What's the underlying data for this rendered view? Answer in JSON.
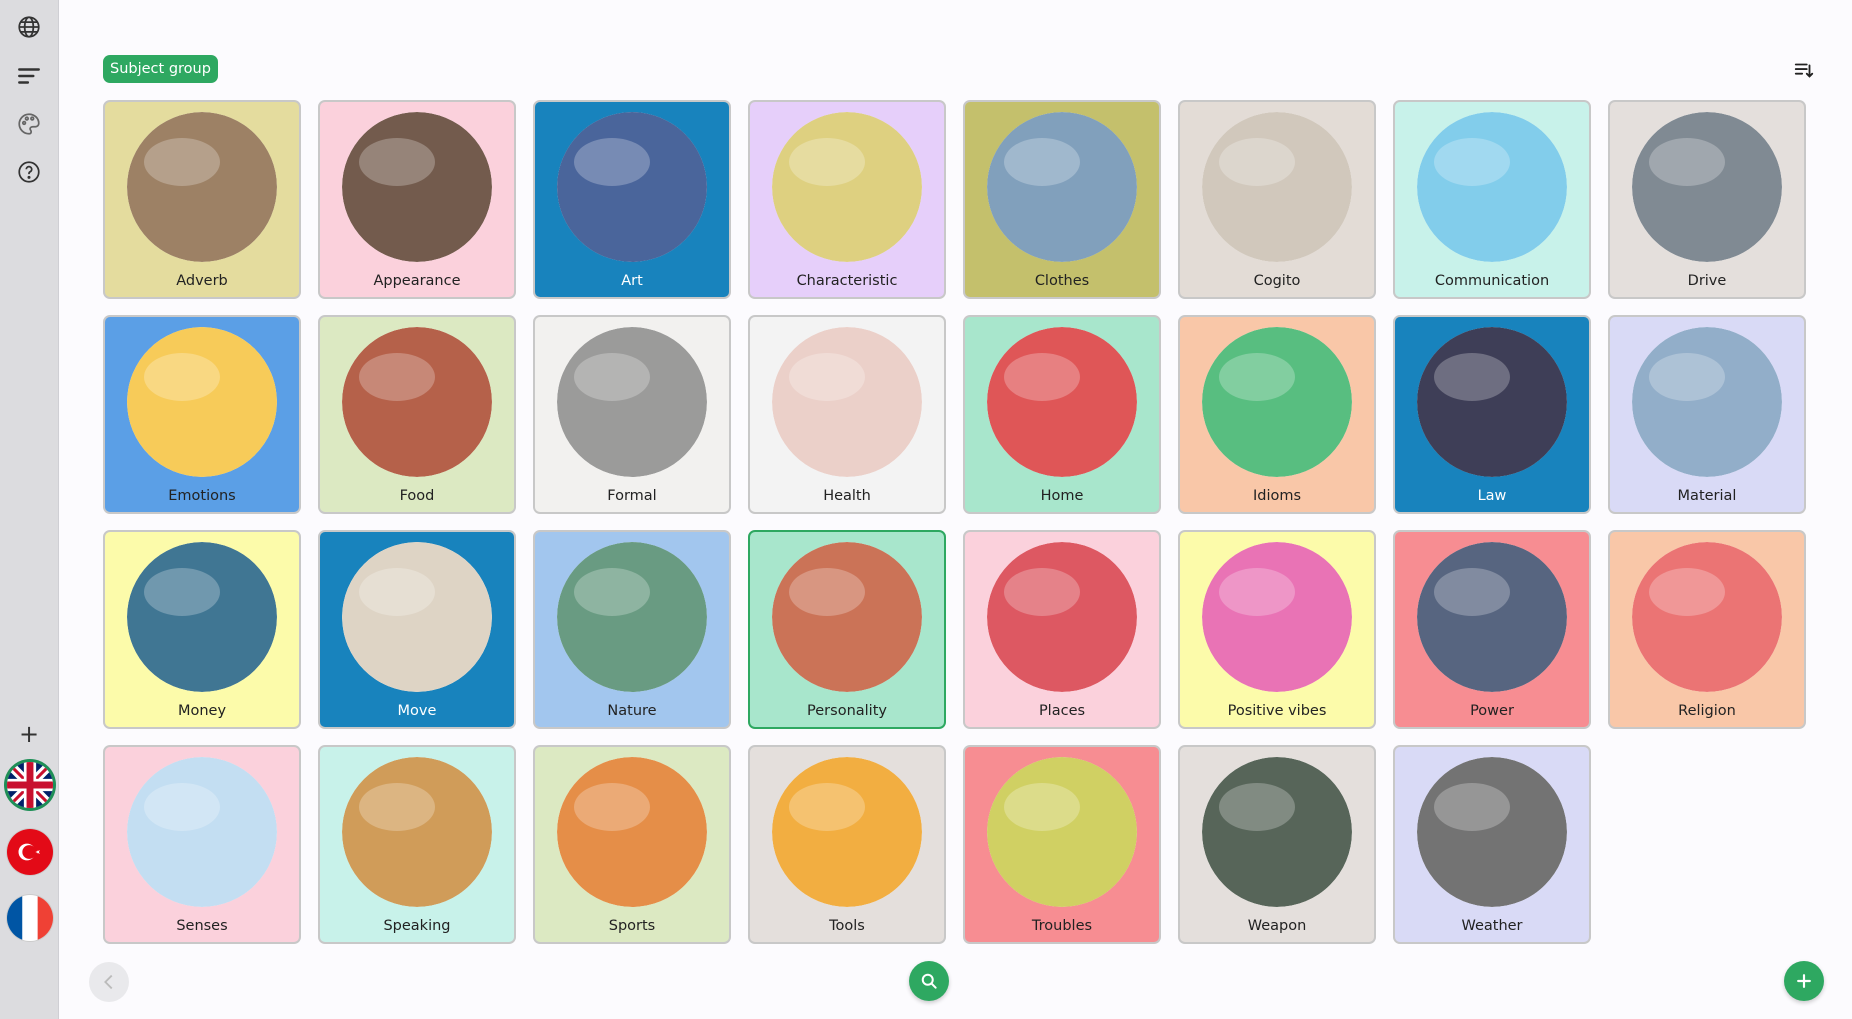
{
  "sidebar": {
    "icons": [
      "globe-icon",
      "filter-lines-icon",
      "palette-icon",
      "help-icon"
    ],
    "add_label": "+",
    "flags": [
      "uk-flag",
      "turkey-flag",
      "france-flag"
    ]
  },
  "header": {
    "chip_label": "Subject group",
    "sort_icon": "sort-icon"
  },
  "tiles": [
    {
      "label": "Adverb",
      "bg": "#e4dc9e",
      "img": "#8c6b4a"
    },
    {
      "label": "Appearance",
      "bg": "#fbd1dc",
      "img": "#5a3e2e"
    },
    {
      "label": "Art",
      "bg": "#1883bd",
      "img": "#2a4a8a",
      "dark": true
    },
    {
      "label": "Characteristic",
      "bg": "#e6cffa",
      "img": "#d8c86a"
    },
    {
      "label": "Clothes",
      "bg": "#c4c06c",
      "img": "#6b8fb0"
    },
    {
      "label": "Cogito",
      "bg": "#e3dcd6",
      "img": "#c9beb0"
    },
    {
      "label": "Communication",
      "bg": "#c8f2ea",
      "img": "#6cc4e8"
    },
    {
      "label": "Drive",
      "bg": "#e4dfdc",
      "img": "#6a7680"
    },
    {
      "label": "Emotions",
      "bg": "#5b9fe6",
      "img": "#f6c23c"
    },
    {
      "label": "Food",
      "bg": "#dce9c2",
      "img": "#a8452a"
    },
    {
      "label": "Formal",
      "bg": "#f2f1ef",
      "img": "#8a8a88"
    },
    {
      "label": "Health",
      "bg": "#f3f3f3",
      "img": "#e8c8c0"
    },
    {
      "label": "Home",
      "bg": "#a8e6cc",
      "img": "#d9383a"
    },
    {
      "label": "Idioms",
      "bg": "#f9c7a8",
      "img": "#3bb36a"
    },
    {
      "label": "Law",
      "bg": "#1883bd",
      "img": "#1c1c3a",
      "dark": true
    },
    {
      "label": "Material",
      "bg": "#d9daf6",
      "img": "#7fa0c0"
    },
    {
      "label": "Money",
      "bg": "#fcfbaa",
      "img": "#1e5e80"
    },
    {
      "label": "Move",
      "bg": "#1883bd",
      "img": "#d8cdbb",
      "dark": true
    },
    {
      "label": "Nature",
      "bg": "#a2c6ee",
      "img": "#4f8a6c"
    },
    {
      "label": "Personality",
      "bg": "#a8e6cc",
      "img": "#c25a3a",
      "selected": true
    },
    {
      "label": "Places",
      "bg": "#fbd1dc",
      "img": "#d73b46"
    },
    {
      "label": "Positive vibes",
      "bg": "#fcfbaa",
      "img": "#e55aa8"
    },
    {
      "label": "Power",
      "bg": "#f78d92",
      "img": "#3a4a6a"
    },
    {
      "label": "Religion",
      "bg": "#f9c7a8",
      "img": "#e85c5c"
    },
    {
      "label": "Senses",
      "bg": "#fbd1dc",
      "img": "#b8d8f0"
    },
    {
      "label": "Speaking",
      "bg": "#c8f2ea",
      "img": "#c88b3c"
    },
    {
      "label": "Sports",
      "bg": "#dce9c2",
      "img": "#e07a28"
    },
    {
      "label": "Tools",
      "bg": "#e4dfdc",
      "img": "#f0a020"
    },
    {
      "label": "Troubles",
      "bg": "#f78d92",
      "img": "#c8c848"
    },
    {
      "label": "Weapon",
      "bg": "#e4dfdc",
      "img": "#3a4a3c"
    },
    {
      "label": "Weather",
      "bg": "#d9daf6",
      "img": "#5a5a5a"
    }
  ],
  "footer": {
    "prev_icon": "chevron-left-icon",
    "search_icon": "search-icon",
    "add_icon": "plus-icon"
  }
}
